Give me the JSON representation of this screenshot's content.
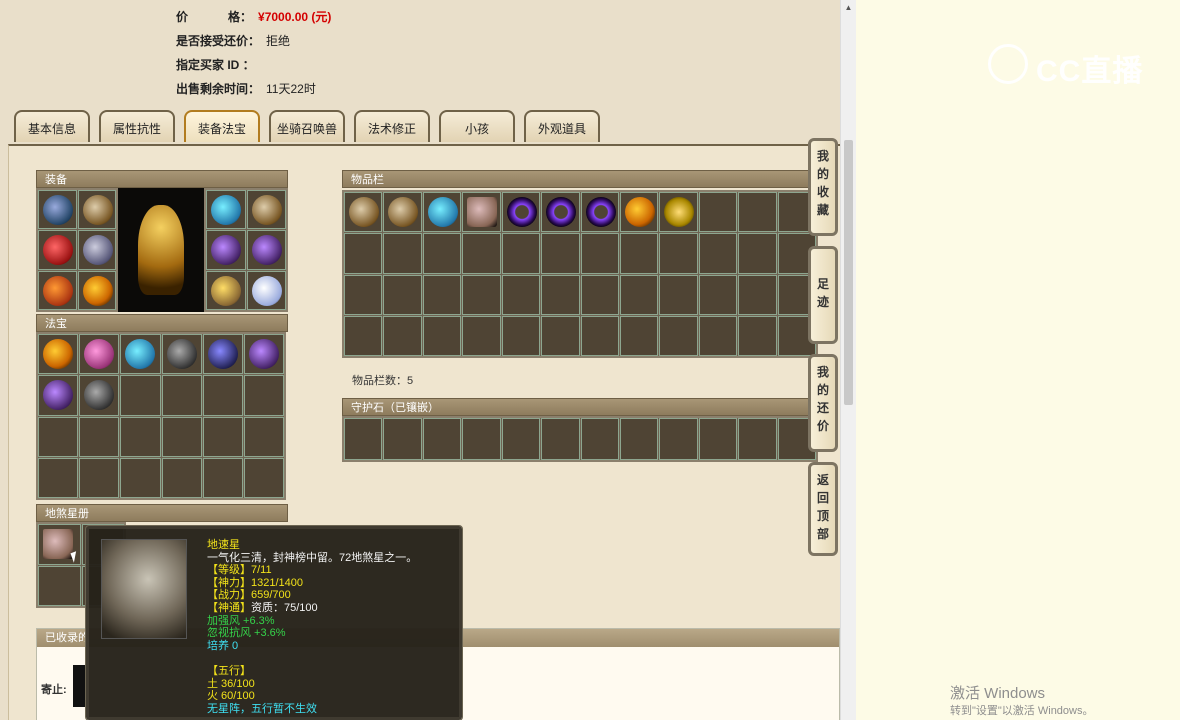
{
  "header": {
    "price_label": "价            格：",
    "price_value": "¥7000.00 (元)",
    "counter_offer_label": "是否接受还价：",
    "counter_offer_value": "拒绝",
    "buyer_id_label": "指定买家 ID ：",
    "buyer_id_value": "",
    "time_left_label": "出售剩余时间：",
    "time_left_value": "11天22时"
  },
  "tabs": [
    {
      "label": "基本信息"
    },
    {
      "label": "属性抗性"
    },
    {
      "label": "装备法宝",
      "active": true
    },
    {
      "label": "坐骑召唤兽"
    },
    {
      "label": "法术修正"
    },
    {
      "label": "小孩"
    },
    {
      "label": "外观道具"
    }
  ],
  "panels": {
    "equipment_title": "装备",
    "fabao_title": "法宝",
    "disha_title": "地煞星册",
    "inventory_title": "物品栏",
    "inventory_count": "物品栏数：5",
    "guardian_title": "守护石（已镶嵌）",
    "collected_title": "已收录的",
    "lower_label": "寄止:"
  },
  "side_nav": [
    {
      "label": "我的收藏"
    },
    {
      "label": "足迹"
    },
    {
      "label": "我的还价"
    },
    {
      "label": "返回顶部"
    }
  ],
  "tooltip": {
    "name": "地速星",
    "desc": "一气化三清，封神榜中留。72地煞星之一。",
    "level_label": "【等级】",
    "level_value": "7/11",
    "shenli_label": "【神力】",
    "shenli_value": "1321/1400",
    "zhanli_label": "【战力】",
    "zhanli_value": "659/700",
    "shentong_label": "【神通】",
    "shentong_value": "资质：75/100",
    "bonus1": "加强风 +6.3%",
    "bonus2": "忽视抗风 +3.6%",
    "peiyang": "培养 0",
    "wuxing_label": "【五行】",
    "wuxing_earth": "土 36/100",
    "wuxing_fire": "火 60/100",
    "wuxing_note": "无星阵，五行暂不生效"
  },
  "watermark": {
    "text": "CC直播"
  },
  "windows": {
    "activate_title": "激活 Windows",
    "activate_sub": "转到\"设置\"以激活 Windows。"
  }
}
